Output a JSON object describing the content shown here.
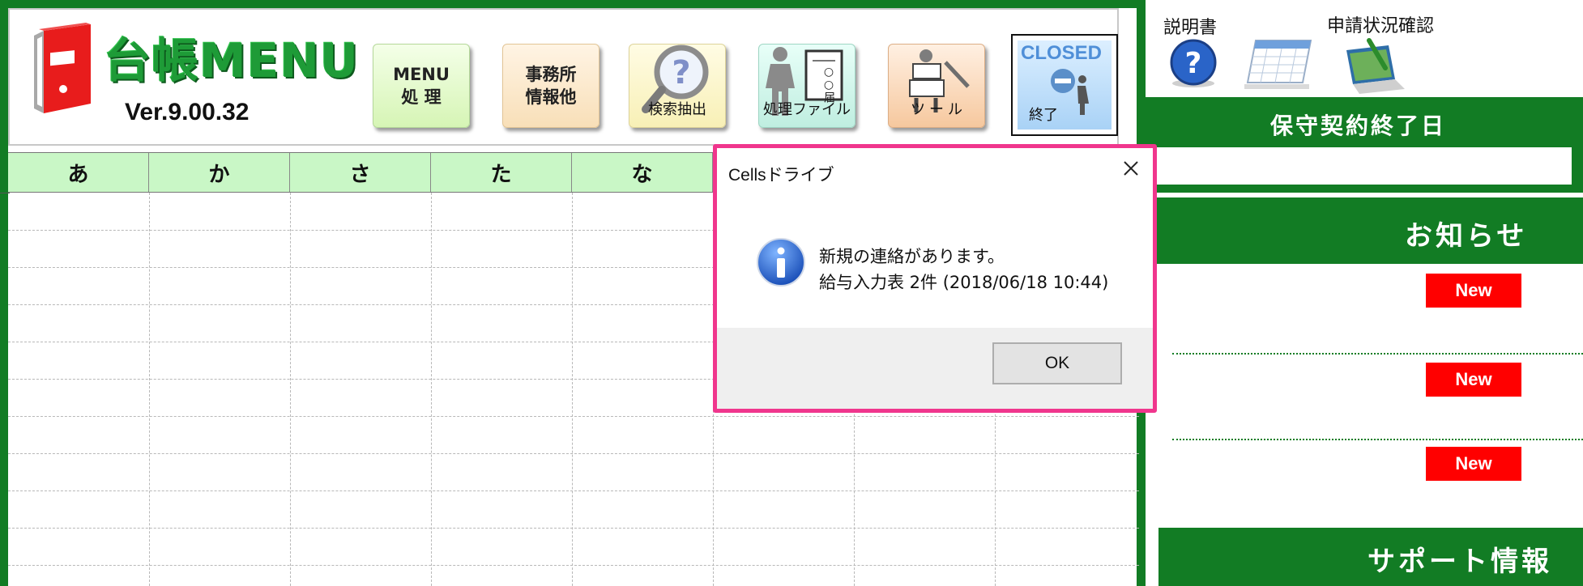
{
  "header": {
    "logo_title": "台帳MENU",
    "version": "Ver.9.00.32",
    "buttons": {
      "menu": "MENU\n処 理",
      "office": "事務所\n情報他",
      "search_caption": "検索抽出",
      "file_caption": "処理ファイル",
      "file_inner": "○○届",
      "tool_caption": "ツ ー ル",
      "closed_top": "CLOSED",
      "closed_caption": "終了"
    }
  },
  "columns": [
    "あ",
    "か",
    "さ",
    "た",
    "な",
    "",
    "",
    ""
  ],
  "right_panel": {
    "manual_label": "説明書",
    "status_label": "申請状況確認",
    "maintenance_title": "保守契約終了日",
    "news_title": "お知らせ",
    "new_badge": "New",
    "support_title": "サポート情報"
  },
  "dialog": {
    "title": "Cellsドライブ",
    "line1": "新規の連絡があります。",
    "line2": "給与入力表 2件 (2018/06/18 10:44)",
    "ok": "OK"
  },
  "colors": {
    "brand_green": "#127c24",
    "header_row": "#c9f7c6",
    "dialog_border": "#f0368d",
    "badge_red": "#ff0000"
  }
}
